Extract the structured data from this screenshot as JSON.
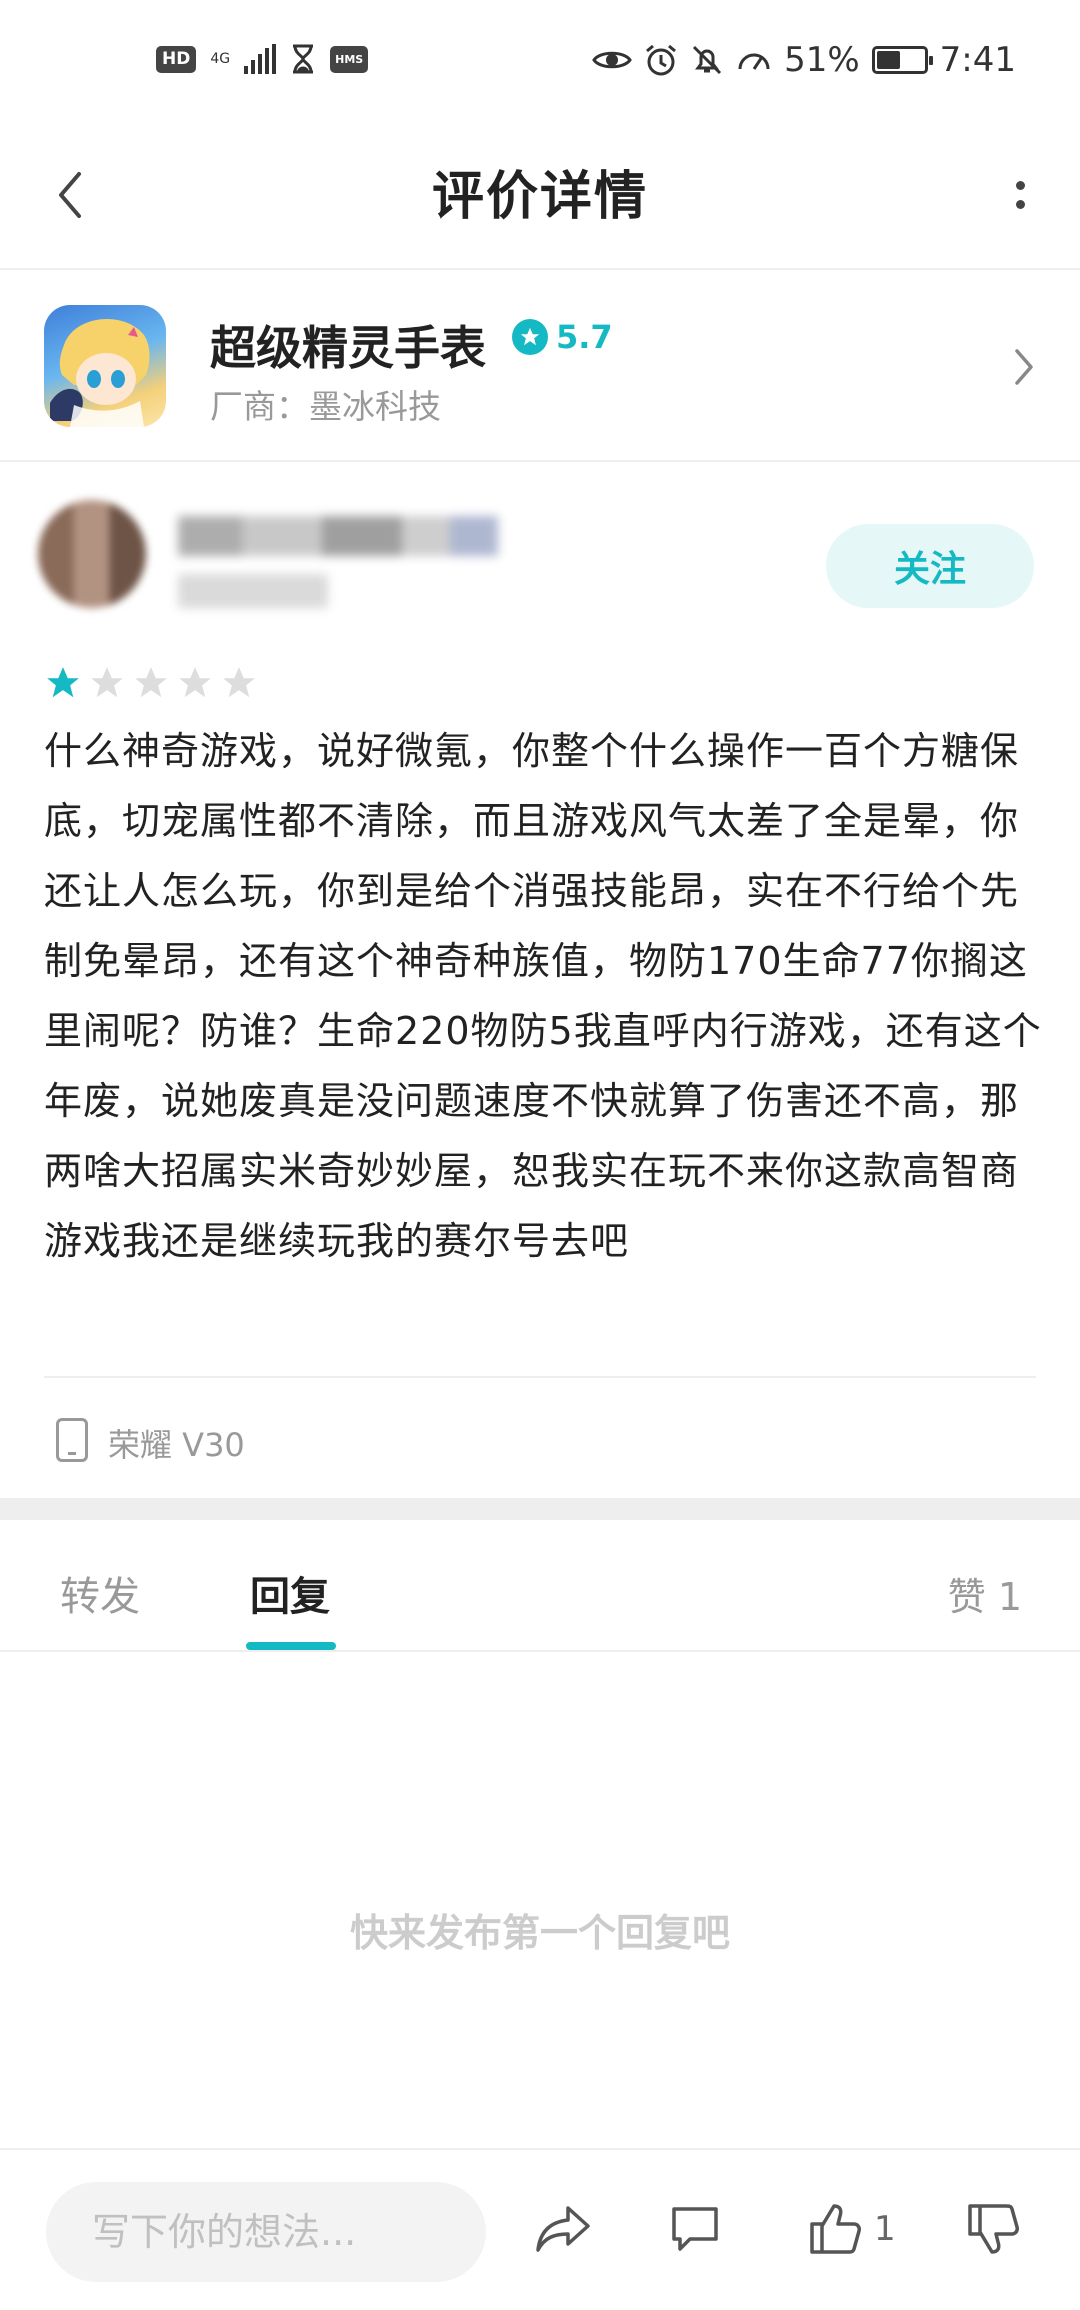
{
  "status_bar": {
    "hd_label": "HD",
    "network_label": "4G",
    "hms_label": "HMS",
    "battery_percent": "51%",
    "battery_level": 0.51,
    "time": "7:41"
  },
  "header": {
    "title": "评价详情"
  },
  "app": {
    "name": "超级精灵手表",
    "rating": "5.7",
    "vendor": "厂商：墨冰科技"
  },
  "review": {
    "follow_label": "关注",
    "stars_filled": 1,
    "stars_total": 5,
    "text": "什么神奇游戏，说好微氪，你整个什么操作一百个方糖保底，切宠属性都不清除，而且游戏风气太差了全是晕，你还让人怎么玩，你到是给个消强技能昂，实在不行给个先制免晕昂，还有这个神奇种族值，物防170生命77你搁这里闹呢？防谁？生命220物防5我直呼内行游戏，还有这个年废，说她废真是没问题速度不快就算了伤害还不高，那两啥大招属实米奇妙妙屋，恕我实在玩不来你这款高智商游戏我还是继续玩我的赛尔号去吧",
    "device": "荣耀 V30"
  },
  "tabs": {
    "forward": "转发",
    "reply": "回复",
    "likes": "赞 1"
  },
  "empty_hint": "快来发布第一个回复吧",
  "bottom_bar": {
    "placeholder": "写下你的想法...",
    "like_count": "1"
  },
  "colors": {
    "accent": "#15b9c3",
    "star_empty": "#dddddd",
    "text_primary": "#222222",
    "text_secondary": "#999999"
  }
}
